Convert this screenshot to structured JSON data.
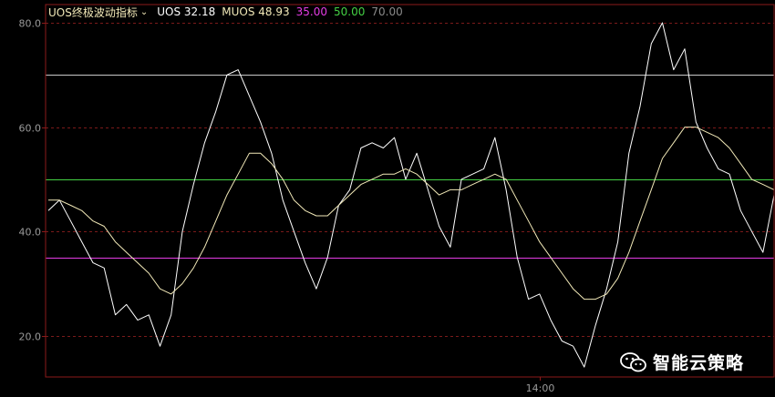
{
  "legend": {
    "indicator_name": "UOS终极波动指标",
    "uos_label": "UOS 32.18",
    "muos_label": "MUOS 48.93",
    "level_low": "35.00",
    "level_mid": "50.00",
    "level_high": "70.00"
  },
  "watermark": "智能云策略",
  "colors": {
    "background": "#000000",
    "frame": "#8b1a1a",
    "gridline": "#7a1a1a",
    "uos": "#ffffff",
    "muos": "#f2e9b8",
    "level_low": "#e43ce4",
    "level_mid": "#44d144",
    "level_high": "#c8c8c8",
    "axis_text": "#9a9a9a"
  },
  "chart_data": {
    "type": "line",
    "title": "UOS终极波动指标",
    "xlabel": "",
    "ylabel": "",
    "ylim": [
      12.1,
      83.5
    ],
    "x_tick_labels": [
      {
        "index": 44,
        "label": "14:00"
      }
    ],
    "y_ticks": [
      20.0,
      40.0,
      60.0,
      80.0
    ],
    "y_tick_labels": [
      "20.0",
      "40.0",
      "60.0",
      "80.0"
    ],
    "grid": true,
    "legend_position": "top-left",
    "reference_lines": [
      {
        "name": "35.00",
        "value": 35.0,
        "color": "#e43ce4"
      },
      {
        "name": "50.00",
        "value": 50.0,
        "color": "#44d144"
      },
      {
        "name": "70.00",
        "value": 70.0,
        "color": "#c8c8c8"
      }
    ],
    "series": [
      {
        "name": "UOS",
        "color": "#ffffff",
        "values": [
          44,
          46,
          42,
          38,
          34,
          33,
          24,
          26,
          23,
          24,
          18,
          24,
          40,
          49,
          57,
          63,
          70,
          71,
          66,
          61,
          55,
          46,
          40,
          34,
          29,
          35,
          45,
          48,
          56,
          57,
          56,
          58,
          50,
          55,
          48,
          41,
          37,
          50,
          51,
          52,
          58,
          48,
          35,
          27,
          28,
          23,
          19,
          18,
          14,
          22,
          29,
          38,
          55,
          64,
          76,
          80,
          71,
          75,
          61,
          56,
          52,
          51,
          44,
          40,
          36,
          47
        ]
      },
      {
        "name": "MUOS",
        "color": "#f2e9b8",
        "values": [
          46,
          46,
          45,
          44,
          42,
          41,
          38,
          36,
          34,
          32,
          29,
          28,
          30,
          33,
          37,
          42,
          47,
          51,
          55,
          55,
          53,
          50,
          46,
          44,
          43,
          43,
          45,
          47,
          49,
          50,
          51,
          51,
          52,
          51,
          49,
          47,
          48,
          48,
          49,
          50,
          51,
          50,
          46,
          42,
          38,
          35,
          32,
          29,
          27,
          27,
          28,
          31,
          36,
          42,
          48,
          54,
          57,
          60,
          60,
          59,
          58,
          56,
          53,
          50,
          49,
          48
        ]
      }
    ]
  }
}
